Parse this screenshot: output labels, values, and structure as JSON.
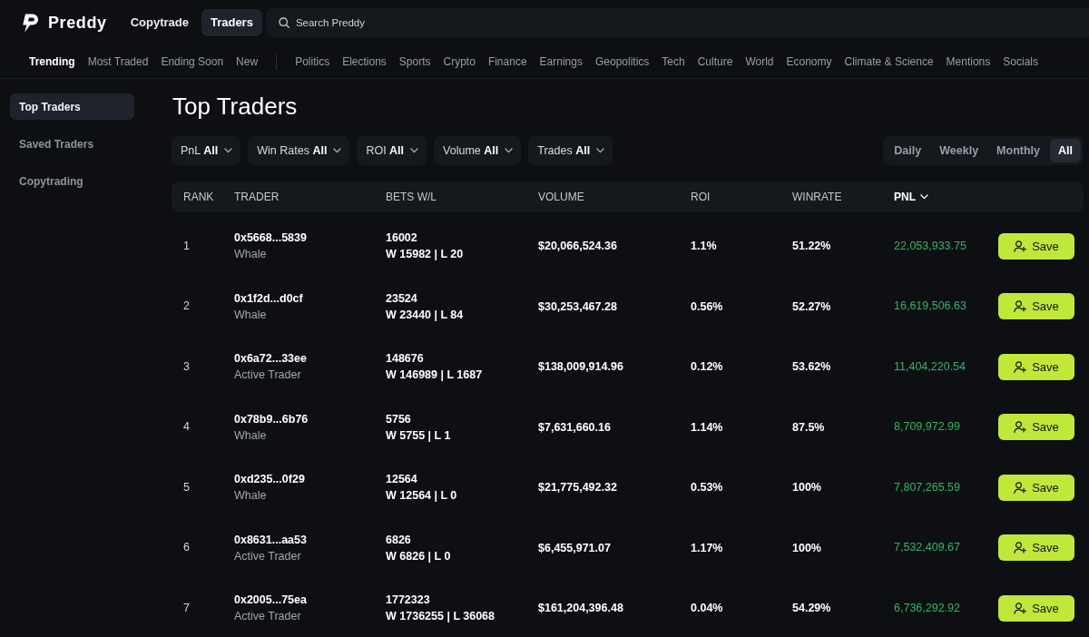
{
  "topbar": {
    "brand": "Preddy",
    "nav": [
      {
        "label": "Copytrade",
        "selected": false
      },
      {
        "label": "Traders",
        "selected": true
      }
    ],
    "search": {
      "placeholder": "Search Preddy"
    }
  },
  "feed_tabs": [
    {
      "label": "Trending",
      "selected": true
    },
    {
      "label": "Most Traded",
      "selected": false
    },
    {
      "label": "Ending Soon",
      "selected": false
    },
    {
      "label": "New",
      "selected": false
    }
  ],
  "topic_tabs": [
    {
      "label": "Politics",
      "selected": false
    },
    {
      "label": "Elections",
      "selected": false
    },
    {
      "label": "Sports",
      "selected": false
    },
    {
      "label": "Crypto",
      "selected": false
    },
    {
      "label": "Finance",
      "selected": false
    },
    {
      "label": "Earnings",
      "selected": false
    },
    {
      "label": "Geopolitics",
      "selected": false
    },
    {
      "label": "Tech",
      "selected": false
    },
    {
      "label": "Culture",
      "selected": false
    },
    {
      "label": "World",
      "selected": false
    },
    {
      "label": "Economy",
      "selected": false
    },
    {
      "label": "Climate & Science",
      "selected": false
    },
    {
      "label": "Mentions",
      "selected": false
    },
    {
      "label": "Socials",
      "selected": false
    }
  ],
  "sidebar": {
    "items": [
      {
        "label": "Top Traders",
        "selected": true
      },
      {
        "label": "Saved Traders",
        "selected": false
      },
      {
        "label": "Copytrading",
        "selected": false
      }
    ]
  },
  "main": {
    "title": "Top Traders",
    "filters": [
      {
        "label": "PnL",
        "value": "All"
      },
      {
        "label": "Win Rates",
        "value": "All"
      },
      {
        "label": "ROI",
        "value": "All"
      },
      {
        "label": "Volume",
        "value": "All"
      },
      {
        "label": "Trades",
        "value": "All"
      }
    ],
    "periods": [
      {
        "label": "Daily",
        "selected": false
      },
      {
        "label": "Weekly",
        "selected": false
      },
      {
        "label": "Monthly",
        "selected": false
      },
      {
        "label": "All",
        "selected": true
      }
    ]
  },
  "table": {
    "columns": [
      {
        "label": "RANK",
        "sorted": false
      },
      {
        "label": "TRADER",
        "sorted": false
      },
      {
        "label": "BETS W/L",
        "sorted": false
      },
      {
        "label": "VOLUME",
        "sorted": false
      },
      {
        "label": "ROI",
        "sorted": false
      },
      {
        "label": "WINRATE",
        "sorted": false
      },
      {
        "label": "PNL",
        "sorted": true
      }
    ],
    "rows": [
      {
        "rank": "1",
        "address": "0x5668...5839",
        "type": "Whale",
        "bets": "16002",
        "wins_losses": "W 15982 | L 20",
        "volume": "$20,066,524.36",
        "roi": "1.1%",
        "winrate": "51.22%",
        "pnl": "22,053,933.75",
        "action": "Save"
      },
      {
        "rank": "2",
        "address": "0x1f2d...d0cf",
        "type": "Whale",
        "bets": "23524",
        "wins_losses": "W 23440 | L 84",
        "volume": "$30,253,467.28",
        "roi": "0.56%",
        "winrate": "52.27%",
        "pnl": "16,619,506.63",
        "action": "Save"
      },
      {
        "rank": "3",
        "address": "0x6a72...33ee",
        "type": "Active Trader",
        "bets": "148676",
        "wins_losses": "W 146989 | L 1687",
        "volume": "$138,009,914.96",
        "roi": "0.12%",
        "winrate": "53.62%",
        "pnl": "11,404,220.54",
        "action": "Save"
      },
      {
        "rank": "4",
        "address": "0x78b9...6b76",
        "type": "Whale",
        "bets": "5756",
        "wins_losses": "W 5755 | L 1",
        "volume": "$7,631,660.16",
        "roi": "1.14%",
        "winrate": "87.5%",
        "pnl": "8,709,972.99",
        "action": "Save"
      },
      {
        "rank": "5",
        "address": "0xd235...0f29",
        "type": "Whale",
        "bets": "12564",
        "wins_losses": "W 12564 | L 0",
        "volume": "$21,775,492.32",
        "roi": "0.53%",
        "winrate": "100%",
        "pnl": "7,807,265.59",
        "action": "Save"
      },
      {
        "rank": "6",
        "address": "0x8631...aa53",
        "type": "Active Trader",
        "bets": "6826",
        "wins_losses": "W 6826 | L 0",
        "volume": "$6,455,971.07",
        "roi": "1.17%",
        "winrate": "100%",
        "pnl": "7,532,409.67",
        "action": "Save"
      },
      {
        "rank": "7",
        "address": "0x2005...75ea",
        "type": "Active Trader",
        "bets": "1772323",
        "wins_losses": "W 1736255 | L 36068",
        "volume": "$161,204,396.48",
        "roi": "0.04%",
        "winrate": "54.29%",
        "pnl": "6,736,292.92",
        "action": "Save"
      }
    ]
  }
}
